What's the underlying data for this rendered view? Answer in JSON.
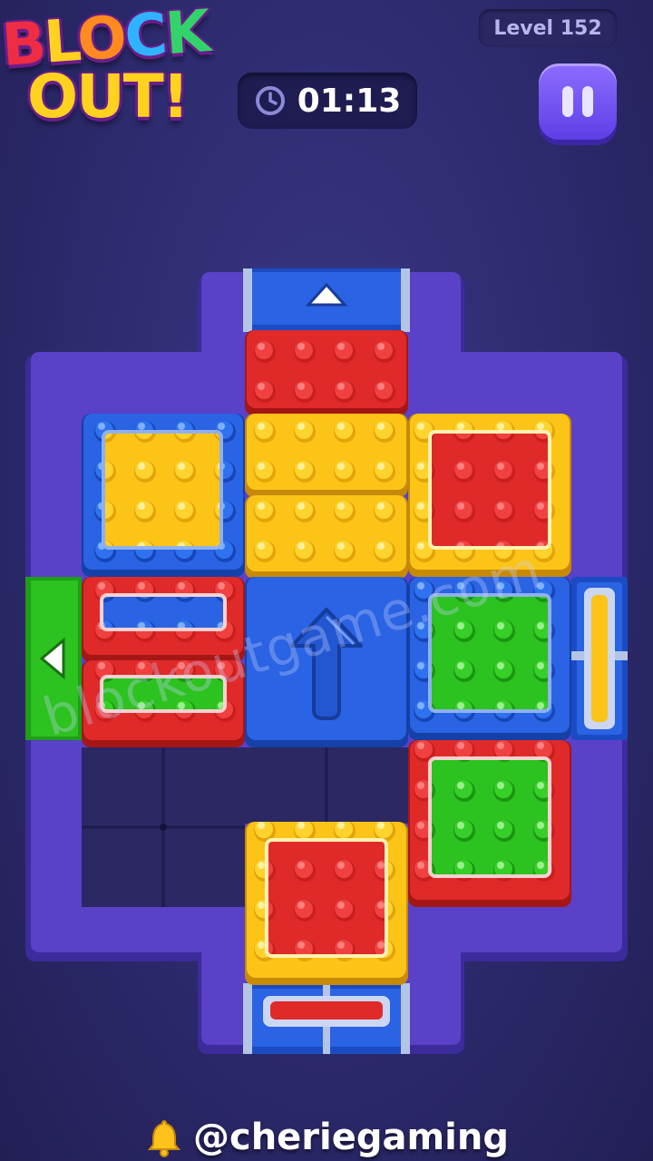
{
  "logo": {
    "word1": [
      "B",
      "L",
      "O",
      "C",
      "K"
    ],
    "word2": "OUT!"
  },
  "hud": {
    "level_label": "Level 152",
    "timer": "01:13"
  },
  "watermark": "blockoutgame.com",
  "footer": {
    "handle": "@cheriegaming",
    "icon": "bell-icon"
  },
  "colors": {
    "red": "#e02a2a",
    "yellow": "#fbc417",
    "blue": "#1f5fe0",
    "green": "#2bbb1f",
    "board": "#5a41c8",
    "board_edge": "#3e2c98",
    "empty_cell": "#2b2864"
  },
  "board": {
    "grid_cols": 4,
    "grid_rows": 6,
    "blocks": [
      {
        "name": "red-block-top",
        "color": "red",
        "inner": null,
        "cells": "r0 c2 w2 h1"
      },
      {
        "name": "blue-yellow-block",
        "color": "blue",
        "inner": "yellow",
        "cells": "r1 c0 w2 h2"
      },
      {
        "name": "yellow-block-mid-1",
        "color": "yellow",
        "inner": null,
        "cells": "r1 c2 w2 h1"
      },
      {
        "name": "yellow-block-mid-2",
        "color": "yellow",
        "inner": null,
        "cells": "r2 c2 w2 h1"
      },
      {
        "name": "yellow-red-block",
        "color": "yellow",
        "inner": "red",
        "cells": "r1 c4 w2 h2"
      },
      {
        "name": "red-blue-bar-block",
        "color": "red",
        "inner": "blue",
        "cells": "r3 c0 w2 h1"
      },
      {
        "name": "red-green-bar-block",
        "color": "red",
        "inner": "green",
        "cells": "r4 c0 w2 h1"
      },
      {
        "name": "blue-arrow-block",
        "color": "blue",
        "inner": "arrow",
        "cells": "r3 c2 w2 h2"
      },
      {
        "name": "blue-green-block",
        "color": "blue",
        "inner": "green",
        "cells": "r3 c4 w2 h2"
      },
      {
        "name": "red-green-block",
        "color": "red",
        "inner": "green",
        "cells": "r5 c4 w2 h2"
      },
      {
        "name": "yellow-red-block-bottom",
        "color": "yellow",
        "inner": "red",
        "cells": "r6 c2 w2 h2"
      }
    ],
    "gates": [
      {
        "name": "blue-gate-top",
        "color": "blue",
        "side": "top",
        "marker": "triangle-up"
      },
      {
        "name": "green-gate-left",
        "color": "green",
        "side": "left",
        "marker": "triangle-left"
      },
      {
        "name": "yellow-gate-right",
        "color": "yellow",
        "side": "right",
        "marker": "bar"
      },
      {
        "name": "red-gate-bottom",
        "color": "red",
        "side": "bottom",
        "marker": "bar"
      }
    ]
  }
}
